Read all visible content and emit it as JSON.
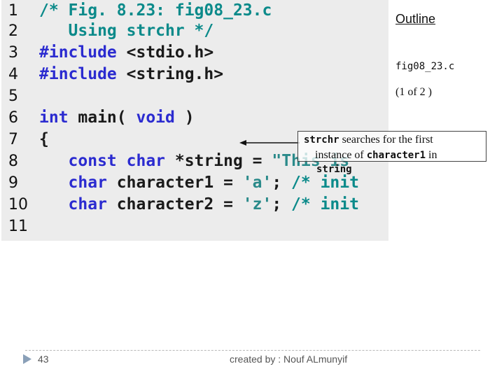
{
  "code_lines": [
    {
      "num": "1",
      "tokens": [
        {
          "t": "/* Fig. 8.23: fig08_23.c",
          "c": "c-comment"
        }
      ]
    },
    {
      "num": "2",
      "tokens": [
        {
          "t": "   Using strchr */",
          "c": "c-comment"
        }
      ]
    },
    {
      "num": "3",
      "tokens": [
        {
          "t": "#include ",
          "c": "c-kw"
        },
        {
          "t": "<stdio.h>",
          "c": "c-plain"
        }
      ]
    },
    {
      "num": "4",
      "tokens": [
        {
          "t": "#include ",
          "c": "c-kw"
        },
        {
          "t": "<string.h>",
          "c": "c-plain"
        }
      ]
    },
    {
      "num": "5",
      "tokens": []
    },
    {
      "num": "6",
      "tokens": [
        {
          "t": "int ",
          "c": "c-kw"
        },
        {
          "t": "main( ",
          "c": "c-plain"
        },
        {
          "t": "void",
          "c": "c-kw"
        },
        {
          "t": " )",
          "c": "c-plain"
        }
      ]
    },
    {
      "num": "7",
      "tokens": [
        {
          "t": "{",
          "c": "c-plain"
        }
      ]
    },
    {
      "num": "8",
      "tokens": [
        {
          "t": "   const char ",
          "c": "c-kw"
        },
        {
          "t": "*string = ",
          "c": "c-plain"
        },
        {
          "t": "\"This is",
          "c": "c-str"
        }
      ]
    },
    {
      "num": "9",
      "tokens": [
        {
          "t": "   char ",
          "c": "c-kw"
        },
        {
          "t": "character1 = ",
          "c": "c-plain"
        },
        {
          "t": "'a'",
          "c": "c-str"
        },
        {
          "t": "; ",
          "c": "c-plain"
        },
        {
          "t": "/* init",
          "c": "c-comment"
        }
      ]
    },
    {
      "num": "10",
      "tokens": [
        {
          "t": "   char ",
          "c": "c-kw"
        },
        {
          "t": "character2 = ",
          "c": "c-plain"
        },
        {
          "t": "'z'",
          "c": "c-str"
        },
        {
          "t": "; ",
          "c": "c-plain"
        },
        {
          "t": "/* init",
          "c": "c-comment"
        }
      ]
    },
    {
      "num": "11",
      "tokens": []
    }
  ],
  "sidebar": {
    "outline_label": "Outline",
    "file_name": "fig08_23.c",
    "page_count": "(1 of 2 )"
  },
  "callout": {
    "line1_code": "strchr",
    "line1_text": " searches for the first",
    "line2_text_a": "instance of ",
    "line2_code": "character1",
    "line2_text_b": " in",
    "line3_code": "string"
  },
  "footer": {
    "page_number": "43",
    "credit": "created by : Nouf ALmunyif"
  }
}
